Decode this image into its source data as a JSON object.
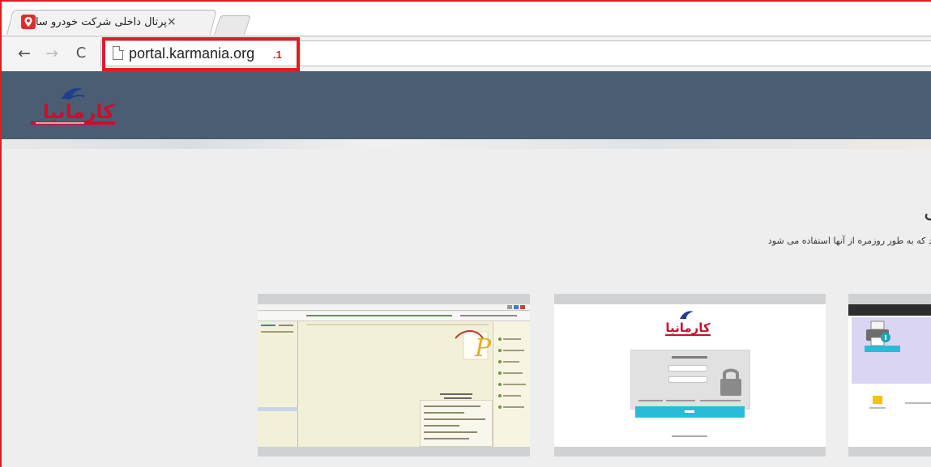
{
  "browser": {
    "tab_title": "پرتال داخلی شرکت خودرو سا",
    "tab_close_glyph": "×",
    "back_glyph": "←",
    "forward_glyph": "→",
    "reload_glyph": "C",
    "url": "portal.karmania.org",
    "url_annotation": ".1",
    "highlight_color": "#e21b23"
  },
  "site": {
    "logo_text": "کارمانیا",
    "header_color": "#4a5d72",
    "heading": "تی",
    "subtext": "تند که به طور روزمره از آنها استفاده می شود"
  },
  "cards": [
    {
      "name": "desktop-app-screenshot"
    },
    {
      "name": "login-page-screenshot",
      "logo_text": "کارمانیا"
    },
    {
      "name": "printer-page-screenshot"
    }
  ]
}
